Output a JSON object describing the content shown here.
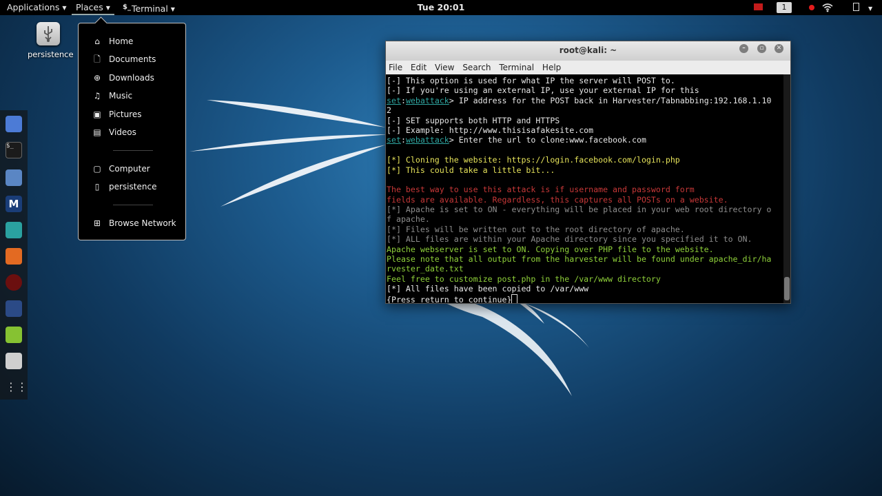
{
  "topbar": {
    "applications": "Applications",
    "places": "Places",
    "terminal_icon": "$_",
    "terminal": "Terminal",
    "clock": "Tue 20:01",
    "workspace": "1",
    "icons": [
      "alert-icon",
      "record-icon",
      "wifi-icon",
      "battery-icon",
      "power-icon"
    ]
  },
  "desktop": {
    "icon_label": "persistence"
  },
  "places_menu": {
    "items": [
      {
        "label": "Home",
        "icon": "home-icon"
      },
      {
        "label": "Documents",
        "icon": "document-icon"
      },
      {
        "label": "Downloads",
        "icon": "download-icon"
      },
      {
        "label": "Music",
        "icon": "music-icon"
      },
      {
        "label": "Pictures",
        "icon": "pictures-icon"
      },
      {
        "label": "Videos",
        "icon": "video-icon"
      },
      {
        "label": "Computer",
        "icon": "computer-icon"
      },
      {
        "label": "persistence",
        "icon": "usb-drive-icon"
      },
      {
        "label": "Browse Network",
        "icon": "network-icon"
      }
    ]
  },
  "terminal": {
    "title": "root@kali: ~",
    "menu": [
      "File",
      "Edit",
      "View",
      "Search",
      "Terminal",
      "Help"
    ],
    "lines": [
      {
        "color": "default",
        "text": "[-] This option is used for what IP the server will POST to."
      },
      {
        "color": "default",
        "text": "[-] If you're using an external IP, use your external IP for this"
      },
      {
        "color": "default",
        "prefix": true,
        "text": "> IP address for the POST back in Harvester/Tabnabbing:192.168.1.10"
      },
      {
        "color": "default",
        "text": "2"
      },
      {
        "color": "default",
        "text": "[-] SET supports both HTTP and HTTPS"
      },
      {
        "color": "default",
        "text": "[-] Example: http://www.thisisafakesite.com"
      },
      {
        "color": "default",
        "prefix": true,
        "text": "> Enter the url to clone:www.facebook.com"
      },
      {
        "color": "default",
        "text": ""
      },
      {
        "color": "yellow",
        "text": "[*] Cloning the website: https://login.facebook.com/login.php"
      },
      {
        "color": "yellow",
        "text": "[*] This could take a little bit..."
      },
      {
        "color": "default",
        "text": ""
      },
      {
        "color": "red",
        "text": "The best way to use this attack is if username and password form"
      },
      {
        "color": "red",
        "text": "fields are available. Regardless, this captures all POSTs on a website."
      },
      {
        "color": "gray",
        "text": "[*] Apache is set to ON - everything will be placed in your web root directory o"
      },
      {
        "color": "gray",
        "text": "f apache."
      },
      {
        "color": "gray",
        "text": "[*] Files will be written out to the root directory of apache."
      },
      {
        "color": "gray",
        "text": "[*] ALL files are within your Apache directory since you specified it to ON."
      },
      {
        "color": "green",
        "text": "Apache webserver is set to ON. Copying over PHP file to the website."
      },
      {
        "color": "green",
        "text": "Please note that all output from the harvester will be found under apache_dir/ha"
      },
      {
        "color": "green",
        "text": "rvester_date.txt"
      },
      {
        "color": "green",
        "text": "Feel free to customize post.php in the /var/www directory"
      },
      {
        "color": "default",
        "text": "[*] All files have been copied to /var/www"
      },
      {
        "color": "default",
        "cursor": true,
        "text": "{Press return to continue}"
      }
    ],
    "prompt": {
      "set": "set",
      "sep": ":",
      "module": "webattack"
    }
  },
  "colors": {
    "accent_teal": "#2fa6a1",
    "yellow": "#e6e35a",
    "red": "#c73838",
    "green": "#8fd13a"
  }
}
